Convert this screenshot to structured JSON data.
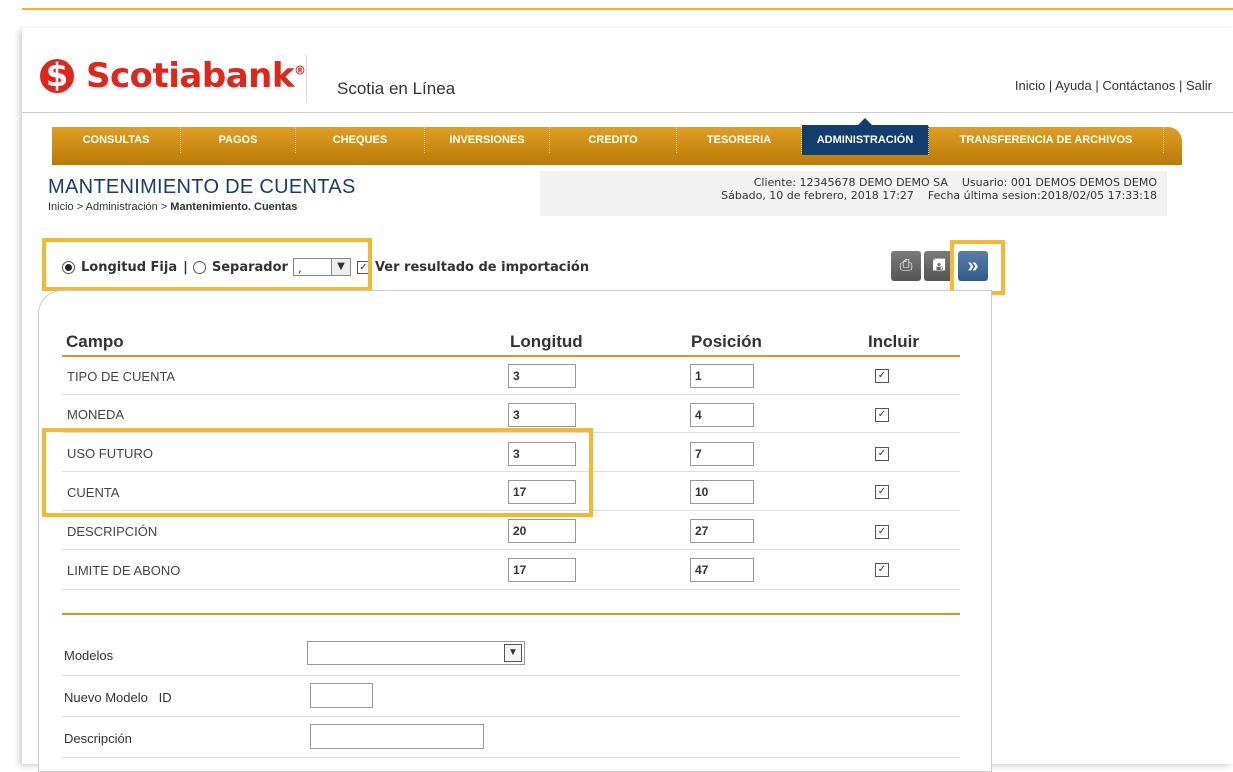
{
  "brand": {
    "logo_text": "Scotiabank",
    "app_name": "Scotia en Línea"
  },
  "top_links": [
    "Inicio",
    "Ayuda",
    "Contáctanos",
    "Salir"
  ],
  "nav": [
    {
      "label": "CONSULTAS"
    },
    {
      "label": "PAGOS"
    },
    {
      "label": "CHEQUES"
    },
    {
      "label": "INVERSIONES"
    },
    {
      "label": "CREDITO"
    },
    {
      "label": "TESORERIA"
    },
    {
      "label": "ADMINISTRACIÓN"
    },
    {
      "label": "TRANSFERENCIA DE ARCHIVOS"
    }
  ],
  "page": {
    "title": "MANTENIMIENTO DE CUENTAS",
    "breadcrumb_prefix": "Inicio > Administración > ",
    "breadcrumb_current": "Mantenimiento. Cuentas"
  },
  "info": {
    "line1": "Cliente: 12345678 DEMO DEMO SA    Usuario: 001 DEMOS DEMOS DEMO",
    "line2": "Sábado, 10 de febrero, 2018 17:27    Fecha última sesion:2018/02/05 17:33:18"
  },
  "options": {
    "fixed_label": "Longitud Fija",
    "separator_label": "Separador",
    "separator_value": ",",
    "import_label": "Ver resultado de importación",
    "selected_mode": "Longitud Fija"
  },
  "table": {
    "headers": {
      "campo": "Campo",
      "longitud": "Longitud",
      "posicion": "Posición",
      "incluir": "Incluir"
    },
    "rows": [
      {
        "campo": "TIPO DE CUENTA",
        "longitud": "3",
        "posicion": "1",
        "incluir": true
      },
      {
        "campo": "MONEDA",
        "longitud": "3",
        "posicion": "4",
        "incluir": true
      },
      {
        "campo": "USO FUTURO",
        "longitud": "3",
        "posicion": "7",
        "incluir": true
      },
      {
        "campo": "CUENTA",
        "longitud": "17",
        "posicion": "10",
        "incluir": true
      },
      {
        "campo": "DESCRIPCIÓN",
        "longitud": "20",
        "posicion": "27",
        "incluir": true
      },
      {
        "campo": "LIMITE DE ABONO",
        "longitud": "17",
        "posicion": "47",
        "incluir": true
      }
    ]
  },
  "form": {
    "modelos_label": "Modelos",
    "modelos_value": "",
    "nuevo_label": "Nuevo Modelo   ID",
    "nuevo_value": "",
    "descripcion_label": "Descripción",
    "descripcion_value": ""
  },
  "icons": {
    "print": "print-icon",
    "save": "save-icon",
    "next": "double-chevron-right-icon"
  },
  "colors": {
    "brand_red": "#e1251b",
    "nav_orange": "#c9880f",
    "nav_active": "#123d6e",
    "highlight": "#f5b82e",
    "title_blue": "#1b3c6c"
  }
}
